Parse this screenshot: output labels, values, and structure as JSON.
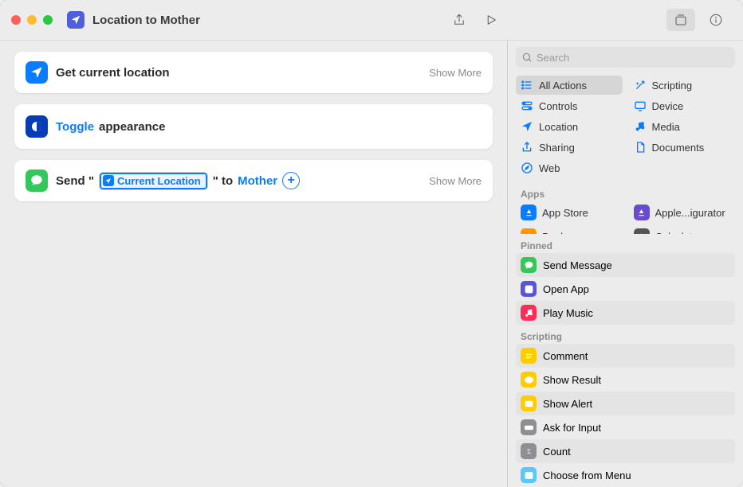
{
  "window": {
    "title": "Location to Mother"
  },
  "actions": [
    {
      "icon": "location-arrow",
      "iconColor": "blue",
      "text": "Get current location",
      "showMore": "Show More",
      "type": "simple"
    },
    {
      "icon": "appearance",
      "iconColor": "darkblue",
      "toggleLabel": "Toggle",
      "suffix": "appearance",
      "type": "toggle"
    },
    {
      "icon": "messages",
      "iconColor": "green",
      "prefix": "Send \"",
      "tokenLabel": "Current Location",
      "mid": "\" to",
      "recipient": "Mother",
      "showMore": "Show More",
      "type": "send"
    }
  ],
  "sidebar": {
    "search": {
      "placeholder": "Search"
    },
    "categories": [
      {
        "key": "all",
        "label": "All Actions",
        "icon": "list",
        "color": "#0a7cff",
        "selected": true
      },
      {
        "key": "scripting",
        "label": "Scripting",
        "icon": "wand",
        "color": "#0a7cff"
      },
      {
        "key": "controls",
        "label": "Controls",
        "icon": "switches",
        "color": "#0a7cff"
      },
      {
        "key": "device",
        "label": "Device",
        "icon": "monitor",
        "color": "#0a7cff"
      },
      {
        "key": "location",
        "label": "Location",
        "icon": "location-arrow",
        "color": "#0a7cff"
      },
      {
        "key": "media",
        "label": "Media",
        "icon": "music-note",
        "color": "#0a7cff"
      },
      {
        "key": "sharing",
        "label": "Sharing",
        "icon": "share",
        "color": "#0a7cff"
      },
      {
        "key": "documents",
        "label": "Documents",
        "icon": "document",
        "color": "#0a7cff"
      },
      {
        "key": "web",
        "label": "Web",
        "icon": "safari",
        "color": "#0a7cff"
      }
    ],
    "appsHeader": "Apps",
    "apps": [
      {
        "label": "App Store",
        "color": "#0a7cff"
      },
      {
        "label": "Apple...igurator",
        "color": "#6a4bd0"
      },
      {
        "label": "Books",
        "color": "#ff9500"
      },
      {
        "label": "Calculator",
        "color": "#555"
      }
    ],
    "pinnedHeader": "Pinned",
    "pinned": [
      {
        "label": "Send Message",
        "color": "#34c759",
        "icon": "message"
      },
      {
        "label": "Open App",
        "color": "#5856d6",
        "icon": "square-arrow"
      },
      {
        "label": "Play Music",
        "color": "#ff2d55",
        "icon": "music"
      }
    ],
    "scriptingHeader": "Scripting",
    "scripting": [
      {
        "label": "Comment",
        "color": "#ffcc00",
        "icon": "lines"
      },
      {
        "label": "Show Result",
        "color": "#ffcc00",
        "icon": "eye"
      },
      {
        "label": "Show Alert",
        "color": "#ffcc00",
        "icon": "alert"
      },
      {
        "label": "Ask for Input",
        "color": "#8e8e93",
        "icon": "input"
      },
      {
        "label": "Count",
        "color": "#8e8e93",
        "icon": "sigma"
      },
      {
        "label": "Choose from Menu",
        "color": "#5ac8fa",
        "icon": "menu"
      }
    ]
  }
}
